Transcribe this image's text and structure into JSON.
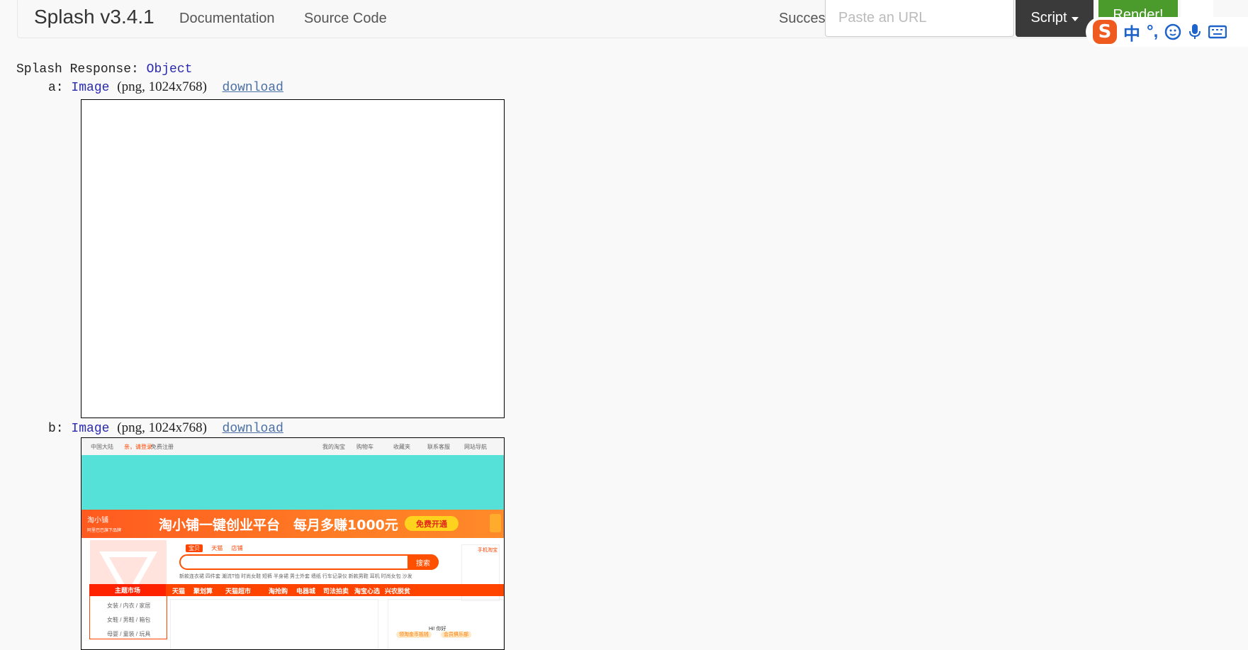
{
  "navbar": {
    "brand": "Splash v3.4.1",
    "links": [
      "Documentation",
      "Source Code"
    ],
    "status": "Success",
    "url_placeholder": "Paste an URL",
    "script_button": "Script",
    "render_button": "Render!"
  },
  "ime_toolbar": {
    "logo": "S",
    "mode": "中",
    "punct": "°,",
    "icons": [
      "emoji-icon",
      "microphone-icon",
      "keyboard-icon"
    ]
  },
  "response": {
    "heading_label": "Splash Response:",
    "heading_type": "Object",
    "items": [
      {
        "key": "a:",
        "type": "Image",
        "meta": "(png, 1024x768)",
        "link": "download",
        "content": "blank"
      },
      {
        "key": "b:",
        "type": "Image",
        "meta": "(png, 1024x768)",
        "link": "download",
        "content": "taobao-screenshot"
      }
    ]
  },
  "thumbnail_b": {
    "top_left": [
      "中国大陆",
      "亲，请登录",
      "免费注册"
    ],
    "top_right": [
      "我的淘宝",
      "购物车",
      "收藏夹",
      "联系客服",
      "网站导航"
    ],
    "banner_logo": "淘小铺",
    "banner_sub": "阿里巴巴旗下品牌",
    "banner_title": "淘小铺一键创业平台　每月多赚1000元",
    "banner_button": "免费开通",
    "search_tabs": [
      "宝贝",
      "天猫",
      "店铺"
    ],
    "search_button": "搜索",
    "hot_words": "新款连衣裙 四件套 潮流T恤 时尚女鞋 短裤 半身裙 男士外套 墙纸 行车记录仪 新款男鞋 耳机 时尚女包 沙发",
    "side_link": "手机淘宝",
    "nav_theme": "主题市场",
    "nav_items": [
      "天猫",
      "聚划算",
      "天猫超市",
      "淘抢购",
      "电器城",
      "司法拍卖",
      "淘宝心选",
      "兴农脱贫"
    ],
    "categories": [
      "女装 / 内衣 / 家居",
      "女鞋 / 男鞋 / 箱包",
      "母婴 / 童装 / 玩具"
    ],
    "greeting": "Hi! 你好",
    "pills": [
      "领淘金币抵钱",
      "会员俱乐部"
    ],
    "colors": {
      "accent": "#ff4400",
      "cyan": "#56e1d8"
    }
  }
}
